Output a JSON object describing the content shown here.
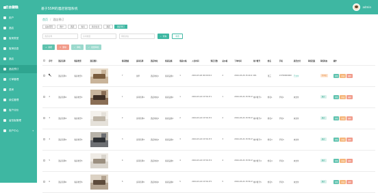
{
  "logo": "后台管理",
  "app_title": "基于SSM的酒店管理系统",
  "user": {
    "name": "admin"
  },
  "sidebar": {
    "items": [
      {
        "label": "后台首页"
      },
      {
        "label": "用户"
      },
      {
        "label": "酒店"
      },
      {
        "label": "客房类型"
      },
      {
        "label": "客房信息"
      },
      {
        "label": "酒店"
      },
      {
        "label": "酒店预订"
      },
      {
        "label": "订单管理"
      },
      {
        "label": "退房"
      },
      {
        "label": "续住管理"
      },
      {
        "label": "客户评价"
      },
      {
        "label": "留言板管理"
      },
      {
        "label": "用户中心"
      }
    ]
  },
  "breadcrumb": {
    "home": "首页",
    "current": "酒店预订"
  },
  "tags": [
    "后台首页",
    "用户",
    "酒店",
    "客房",
    "客房信息",
    "酒店",
    "酒店预订"
  ],
  "search": {
    "p1": "酒店名称",
    "p2": "房间类型",
    "p3": "审核状态",
    "btn": "查询",
    "reset": "重置"
  },
  "toolbar": {
    "add": "新增",
    "delete": "删除",
    "audit": "审核",
    "export": "批量审核"
  },
  "headers": [
    "",
    "序号",
    "酒店名称",
    "客房类型",
    "酒店图片",
    "客房数量",
    "房间名称",
    "酒店地址",
    "客房设施",
    "客房价格",
    "入住时间",
    "预定天数",
    "总价格",
    "下单时间",
    "用户账号",
    "姓名",
    "手机",
    "是否支付",
    "审核回复",
    "审核状态",
    "操作"
  ],
  "rows": [
    {
      "no": "1",
      "hotel": "酒店名称1",
      "type": "客房类型1",
      "count": "7",
      "room": "豪华",
      "addr": "酒店地址1",
      "fac": "客房设施1",
      "price": "1",
      "checkin": "2024-03-26 00:00:00",
      "days": "2",
      "total": "2",
      "ordered": "2024-03-26 15:40:41",
      "account": "001",
      "name": "张三",
      "phone": "13700000000",
      "pay": "已支付",
      "reply": "",
      "status": "待审核"
    },
    {
      "no": "2",
      "hotel": "酒店名称2",
      "type": "客房类型2",
      "count": "1",
      "room": "房间名称1",
      "addr": "酒店地址2",
      "fac": "客房设施2",
      "price": "1",
      "checkin": "2024-03-24 15:56:15",
      "days": "1",
      "total": "1",
      "ordered": "2024-03-24 15:56:15",
      "account": "用户账号1",
      "name": "姓名1",
      "phone": "手机1",
      "pay": "未支付",
      "reply": "",
      "status": "通过"
    },
    {
      "no": "3",
      "hotel": "酒店名称3",
      "type": "客房类型3",
      "count": "2",
      "room": "房间名称2",
      "addr": "酒店地址3",
      "fac": "客房设施3",
      "price": "2",
      "checkin": "2024-03-24 15:56:15",
      "days": "2",
      "total": "2",
      "ordered": "2024-03-24 15:56:15",
      "account": "用户账号2",
      "name": "姓名2",
      "phone": "手机2",
      "pay": "未支付",
      "reply": "",
      "status": "通过"
    },
    {
      "no": "4",
      "hotel": "酒店名称4",
      "type": "客房类型4",
      "count": "3",
      "room": "房间名称3",
      "addr": "酒店地址4",
      "fac": "客房设施4",
      "price": "3",
      "checkin": "2024-03-24 15:56:15",
      "days": "3",
      "total": "3",
      "ordered": "2024-03-24 15:56:15",
      "account": "用户账号3",
      "name": "姓名3",
      "phone": "手机3",
      "pay": "未支付",
      "reply": "",
      "status": "通过"
    },
    {
      "no": "5",
      "hotel": "酒店名称5",
      "type": "客房类型5",
      "count": "4",
      "room": "房间名称4",
      "addr": "酒店地址5",
      "fac": "客房设施5",
      "price": "4",
      "checkin": "2024-03-24 15:56:15",
      "days": "4",
      "total": "4",
      "ordered": "2024-03-24 15:56:15",
      "account": "用户账号4",
      "name": "姓名4",
      "phone": "手机4",
      "pay": "未支付",
      "reply": "",
      "status": "通过"
    },
    {
      "no": "6",
      "hotel": "酒店名称6",
      "type": "客房类型6",
      "count": "5",
      "room": "房间名称5",
      "addr": "酒店地址6",
      "fac": "客房设施6",
      "price": "5",
      "checkin": "2024-03-24 15:56:15",
      "days": "5",
      "total": "5",
      "ordered": "2024-03-24 15:56:15",
      "account": "用户账号5",
      "name": "姓名5",
      "phone": "手机5",
      "pay": "未支付",
      "reply": "",
      "status": "通过"
    }
  ],
  "actions": {
    "detail": "详情",
    "edit": "修改",
    "delete": "删除"
  },
  "colors": {
    "accent": "#3eb7a2",
    "danger": "#f19b8a",
    "warning": "#f5b67a"
  }
}
